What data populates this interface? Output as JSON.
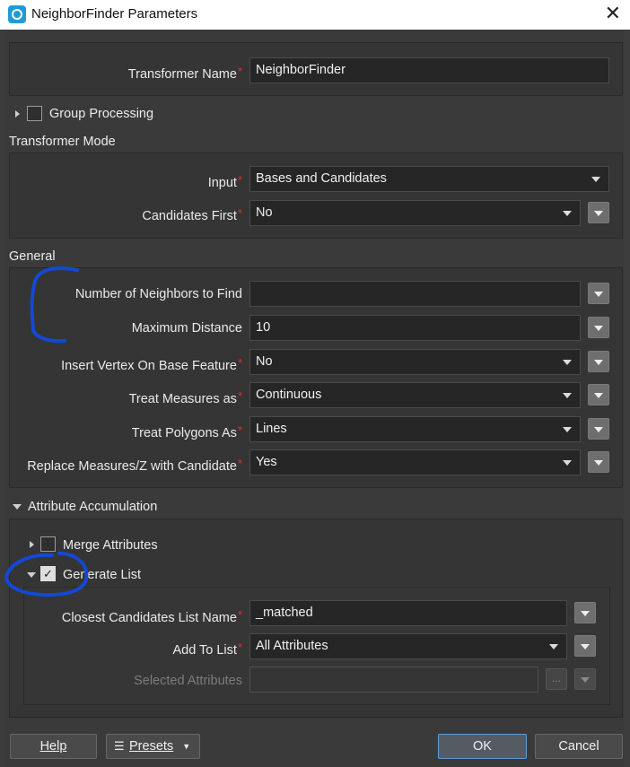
{
  "window": {
    "title": "NeighborFinder Parameters",
    "close_icon": "close-icon"
  },
  "transformer_name": {
    "label": "Transformer Name",
    "value": "NeighborFinder"
  },
  "group_processing": {
    "label": "Group Processing",
    "checked": false
  },
  "transformer_mode": {
    "title": "Transformer Mode",
    "input": {
      "label": "Input",
      "value": "Bases and Candidates"
    },
    "candidates_first": {
      "label": "Candidates First",
      "value": "No"
    }
  },
  "general": {
    "title": "General",
    "num_neighbors": {
      "label": "Number of Neighbors to Find",
      "value": ""
    },
    "max_distance": {
      "label": "Maximum Distance",
      "value": "10"
    },
    "insert_vertex": {
      "label": "Insert Vertex On Base Feature",
      "value": "No"
    },
    "treat_measures": {
      "label": "Treat Measures as",
      "value": "Continuous"
    },
    "treat_polygons": {
      "label": "Treat Polygons As",
      "value": "Lines"
    },
    "replace_measures": {
      "label": "Replace Measures/Z with Candidate",
      "value": "Yes"
    }
  },
  "attribute_accumulation": {
    "title": "Attribute Accumulation",
    "merge_attributes": {
      "label": "Merge Attributes",
      "checked": false
    },
    "generate_list": {
      "label": "Generate List",
      "checked": true,
      "check_glyph": "✓",
      "list_name": {
        "label": "Closest Candidates List Name",
        "value": "_matched"
      },
      "add_to_list": {
        "label": "Add To List",
        "value": "All Attributes"
      },
      "selected_attributes": {
        "label": "Selected Attributes",
        "value": "",
        "browse": "..."
      }
    }
  },
  "buttons": {
    "help": "Help",
    "presets": "Presets",
    "ok": "OK",
    "cancel": "Cancel"
  },
  "colors": {
    "annotation": "#1448d6",
    "required": "#e0302c",
    "ok_border": "#5c9bd6"
  }
}
